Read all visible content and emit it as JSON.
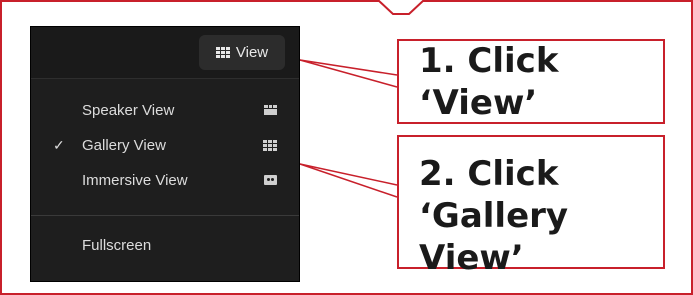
{
  "toolbar": {
    "view_button_label": "View",
    "view_button_icon": "gallery-grid-icon"
  },
  "menu": {
    "items": [
      {
        "label": "Speaker View",
        "checked": false,
        "icon": "speaker-view-icon"
      },
      {
        "label": "Gallery View",
        "checked": true,
        "icon": "gallery-grid-icon"
      },
      {
        "label": "Immersive View",
        "checked": false,
        "icon": "immersive-view-icon"
      },
      {
        "label": "Fullscreen",
        "checked": false,
        "icon": ""
      }
    ],
    "check_mark": "✓"
  },
  "callouts": {
    "step1": "1. Click ‘View’",
    "step2_line1": "2. Click",
    "step2_line2": "‘Gallery View’"
  },
  "colors": {
    "accent": "#c8202b",
    "menu_bg": "#1e1e1e",
    "text": "#dcdcdc"
  }
}
